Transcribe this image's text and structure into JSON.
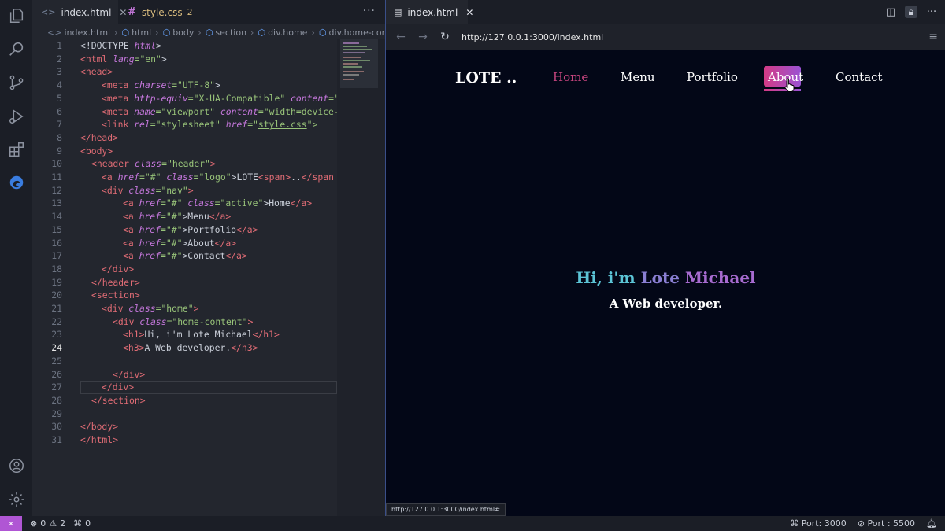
{
  "editor": {
    "tabs": [
      {
        "label": "index.html",
        "close": "✕"
      },
      {
        "label": "style.css",
        "count": "2"
      }
    ],
    "more": "···",
    "breadcrumb": [
      "index.html",
      "html",
      "body",
      "section",
      "div.home",
      "div.home-conte"
    ],
    "current_line": "24",
    "lines": [
      {
        "n": "1"
      },
      {
        "n": "2"
      },
      {
        "n": "3"
      },
      {
        "n": "4"
      },
      {
        "n": "5"
      },
      {
        "n": "6"
      },
      {
        "n": "7"
      },
      {
        "n": "8"
      },
      {
        "n": "9"
      },
      {
        "n": "10"
      },
      {
        "n": "11"
      },
      {
        "n": "12"
      },
      {
        "n": "13"
      },
      {
        "n": "14"
      },
      {
        "n": "15"
      },
      {
        "n": "16"
      },
      {
        "n": "17"
      },
      {
        "n": "18"
      },
      {
        "n": "19"
      },
      {
        "n": "20"
      },
      {
        "n": "21"
      },
      {
        "n": "22"
      },
      {
        "n": "23"
      },
      {
        "n": "24"
      },
      {
        "n": "25"
      },
      {
        "n": "26"
      },
      {
        "n": "27"
      },
      {
        "n": "28"
      },
      {
        "n": "29"
      },
      {
        "n": "30"
      },
      {
        "n": "31"
      }
    ],
    "code": {
      "l1_a": "<!DOCTYPE ",
      "l1_b": "html",
      "l1_c": ">",
      "l2_a": "<html ",
      "l2_b": "lang",
      "l2_c": "=\"en\"",
      "l2_d": ">",
      "l3": "<head>",
      "l4_a": "<meta ",
      "l4_b": "charset",
      "l4_c": "=\"UTF-8\"",
      "l4_d": ">",
      "l5_a": "<meta ",
      "l5_b": "http-equiv",
      "l5_c": "=\"X-UA-Compatible\" ",
      "l5_d": "content",
      "l5_e": "=\"",
      "l6_a": "<meta ",
      "l6_b": "name",
      "l6_c": "=\"viewport\" ",
      "l6_d": "content",
      "l6_e": "=\"width=device-",
      "l7_a": "<link ",
      "l7_b": "rel",
      "l7_c": "=\"stylesheet\" ",
      "l7_d": "href",
      "l7_e": "=\"",
      "l7_f": "style.css",
      "l7_g": "\">",
      "l8": "</head>",
      "l9": "<body>",
      "l10_a": "<header ",
      "l10_b": "class",
      "l10_c": "=\"header\"",
      "l10_d": ">",
      "l11_a": "<a ",
      "l11_b": "href",
      "l11_c": "=\"#\" ",
      "l11_d": "class",
      "l11_e": "=\"logo\"",
      "l11_f": ">LOTE",
      "l11_g": "<span>",
      "l11_h": "..",
      "l11_i": "</span",
      "l12_a": "<div ",
      "l12_b": "class",
      "l12_c": "=\"nav\"",
      "l12_d": ">",
      "l13_a": "<a ",
      "l13_b": "href",
      "l13_c": "=\"#\" ",
      "l13_d": "class",
      "l13_e": "=\"active\"",
      "l13_f": ">Home",
      "l13_g": "</a>",
      "l14_a": "<a ",
      "l14_b": "href",
      "l14_c": "=\"#\"",
      "l14_d": ">Menu",
      "l14_e": "</a>",
      "l15_a": "<a ",
      "l15_b": "href",
      "l15_c": "=\"#\"",
      "l15_d": ">Portfolio",
      "l15_e": "</a>",
      "l16_a": "<a ",
      "l16_b": "href",
      "l16_c": "=\"#\"",
      "l16_d": ">About",
      "l16_e": "</a>",
      "l17_a": "<a ",
      "l17_b": "href",
      "l17_c": "=\"#\"",
      "l17_d": ">Contact",
      "l17_e": "</a>",
      "l18": "</div>",
      "l19": "</header>",
      "l20": "<section>",
      "l21_a": "<div ",
      "l21_b": "class",
      "l21_c": "=\"home\"",
      "l21_d": ">",
      "l22_a": "<div ",
      "l22_b": "class",
      "l22_c": "=\"home-content\"",
      "l22_d": ">",
      "l23_a": "<h1>",
      "l23_b": "Hi, i'm Lote Michael",
      "l23_c": "</h1>",
      "l24_a": "<h3>",
      "l24_b": "A Web developer.",
      "l24_c": "</h3>",
      "l26": "</div>",
      "l27": "</div>",
      "l28": "</section>",
      "l30": "</body>",
      "l31": "</html>"
    }
  },
  "browser": {
    "tab_label": "index.html",
    "url": "http://127.0.0.1:3000/index.html",
    "hover_url": "http://127.0.0.1:3000/index.html#",
    "site": {
      "logo": "LOTE ..",
      "nav": [
        "Home",
        "Menu",
        "Portfolio",
        "About",
        "Contact"
      ],
      "active": "Home",
      "hovered": "About",
      "heading_a": "Hi, i'm ",
      "heading_b": "Lote ",
      "heading_c": "Michael",
      "subheading": "A Web developer."
    }
  },
  "status": {
    "errors": "0",
    "warnings": "2",
    "ports_forwarded": "0",
    "port": "Port: 3000",
    "live_port": "Port : 5500"
  },
  "colors": {
    "accent": "#b056d4",
    "active_link": "#c7457f",
    "gradient_start": "#d43b85",
    "gradient_end": "#9a52d4"
  }
}
